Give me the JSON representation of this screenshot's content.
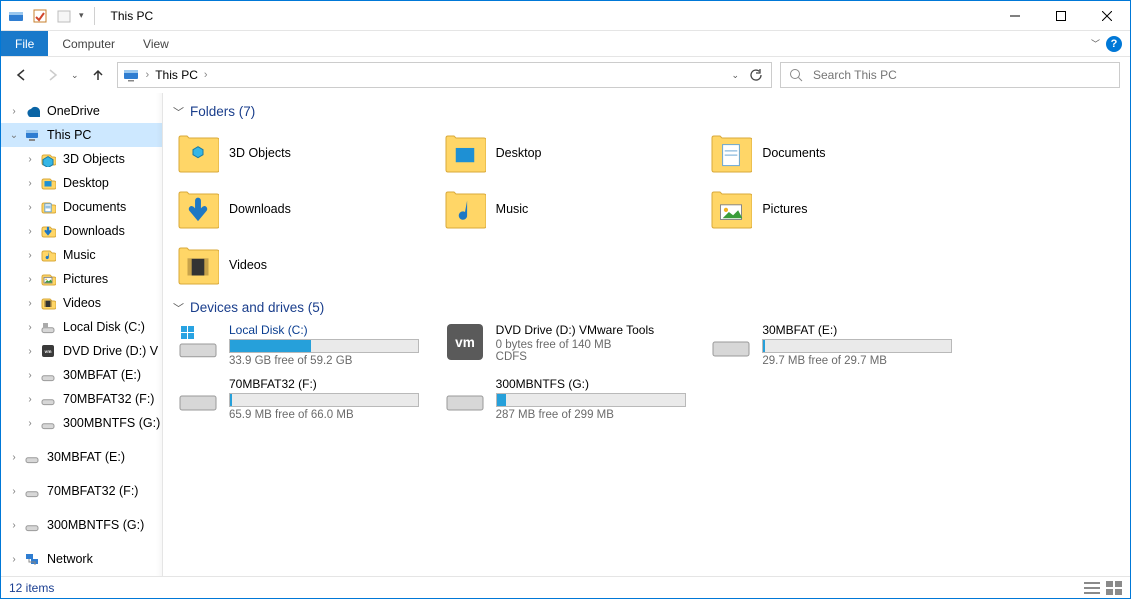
{
  "title": "This PC",
  "menubar": {
    "file": "File",
    "tabs": [
      "Computer",
      "View"
    ]
  },
  "address": {
    "location": "This PC",
    "search_placeholder": "Search This PC"
  },
  "nav": {
    "groups": [
      {
        "label": "OneDrive",
        "depth": 1,
        "expandable": true,
        "expanded": false,
        "icon": "onedrive"
      },
      {
        "label": "This PC",
        "depth": 1,
        "expandable": true,
        "expanded": true,
        "selected": true,
        "icon": "pc"
      },
      {
        "label": "3D Objects",
        "depth": 2,
        "expandable": true,
        "icon": "3d"
      },
      {
        "label": "Desktop",
        "depth": 2,
        "expandable": true,
        "icon": "desktop"
      },
      {
        "label": "Documents",
        "depth": 2,
        "expandable": true,
        "icon": "documents"
      },
      {
        "label": "Downloads",
        "depth": 2,
        "expandable": true,
        "icon": "downloads"
      },
      {
        "label": "Music",
        "depth": 2,
        "expandable": true,
        "icon": "music"
      },
      {
        "label": "Pictures",
        "depth": 2,
        "expandable": true,
        "icon": "pictures"
      },
      {
        "label": "Videos",
        "depth": 2,
        "expandable": true,
        "icon": "videos"
      },
      {
        "label": "Local Disk (C:)",
        "depth": 2,
        "expandable": true,
        "icon": "hdd"
      },
      {
        "label": "DVD Drive (D:) V",
        "depth": 2,
        "expandable": true,
        "icon": "dvd"
      },
      {
        "label": "30MBFAT (E:)",
        "depth": 2,
        "expandable": true,
        "icon": "usb"
      },
      {
        "label": "70MBFAT32 (F:)",
        "depth": 2,
        "expandable": true,
        "icon": "usb"
      },
      {
        "label": "300MBNTFS (G:)",
        "depth": 2,
        "expandable": true,
        "icon": "usb"
      },
      {
        "spacer": true
      },
      {
        "label": "30MBFAT (E:)",
        "depth": 1,
        "expandable": true,
        "icon": "usb"
      },
      {
        "spacer": true
      },
      {
        "label": "70MBFAT32 (F:)",
        "depth": 1,
        "expandable": true,
        "icon": "usb"
      },
      {
        "spacer": true
      },
      {
        "label": "300MBNTFS (G:)",
        "depth": 1,
        "expandable": true,
        "icon": "usb"
      },
      {
        "spacer": true
      },
      {
        "label": "Network",
        "depth": 1,
        "expandable": true,
        "icon": "network"
      }
    ]
  },
  "groups": {
    "folders": {
      "title": "Folders (7)",
      "items": [
        {
          "label": "3D Objects",
          "icon": "3d"
        },
        {
          "label": "Desktop",
          "icon": "desktop"
        },
        {
          "label": "Documents",
          "icon": "documents"
        },
        {
          "label": "Downloads",
          "icon": "downloads"
        },
        {
          "label": "Music",
          "icon": "music"
        },
        {
          "label": "Pictures",
          "icon": "pictures"
        },
        {
          "label": "Videos",
          "icon": "videos"
        }
      ]
    },
    "drives": {
      "title": "Devices and drives (5)",
      "items": [
        {
          "name": "Local Disk (C:)",
          "nameLink": true,
          "sub": "33.9 GB free of 59.2 GB",
          "icon": "winhdd",
          "bar": true,
          "barPct": 43
        },
        {
          "name": "DVD Drive (D:) VMware Tools",
          "sub": "0 bytes free of 140 MB",
          "sub2": "CDFS",
          "icon": "vm",
          "bar": false
        },
        {
          "name": "30MBFAT (E:)",
          "sub": "29.7 MB free of 29.7 MB",
          "icon": "driveflat",
          "bar": true,
          "barPct": 1
        },
        {
          "name": "70MBFAT32 (F:)",
          "sub": "65.9 MB free of 66.0 MB",
          "icon": "driveflat",
          "bar": true,
          "barPct": 1
        },
        {
          "name": "300MBNTFS (G:)",
          "sub": "287 MB free of 299 MB",
          "icon": "driveflat",
          "bar": true,
          "barPct": 5
        }
      ]
    }
  },
  "status": {
    "left": "12 items"
  }
}
